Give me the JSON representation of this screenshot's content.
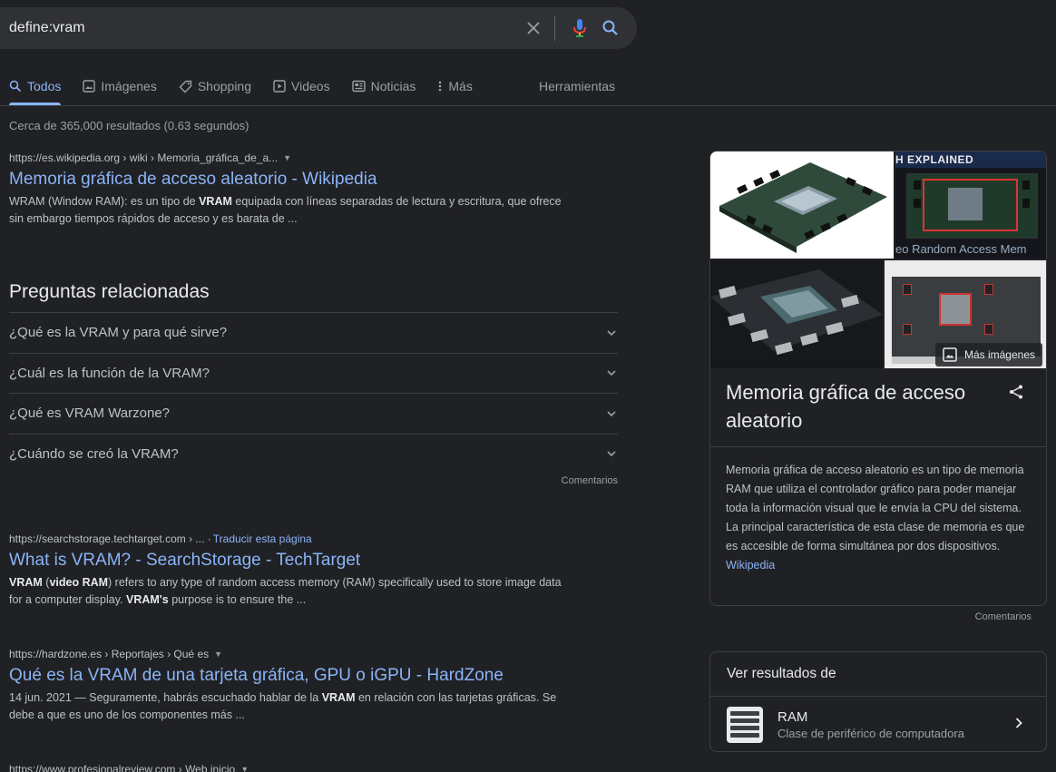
{
  "search": {
    "query": "define:vram"
  },
  "tabs": [
    {
      "label": "Todos",
      "icon": "search-icon"
    },
    {
      "label": "Imágenes",
      "icon": "image-icon"
    },
    {
      "label": "Shopping",
      "icon": "tag-icon"
    },
    {
      "label": "Videos",
      "icon": "video-icon"
    },
    {
      "label": "Noticias",
      "icon": "news-icon"
    },
    {
      "label": "Más",
      "icon": "more-vert-icon"
    }
  ],
  "tools_label": "Herramientas",
  "stats": "Cerca de 365,000 resultados (0.63 segundos)",
  "results": [
    {
      "cite": "https://es.wikipedia.org › wiki › Memoria_gráfica_de_a...",
      "title": "Memoria gráfica de acceso aleatorio - Wikipedia",
      "snippet": [
        {
          "t": "WRAM (Window RAM): es un tipo de "
        },
        {
          "t": "VRAM",
          "b": true
        },
        {
          "t": " equipada con líneas separadas de lectura y escritura, que ofrece sin embargo tiempos rápidos de acceso y es barata de ..."
        }
      ]
    },
    {
      "cite": "https://searchstorage.techtarget.com › ... ·",
      "translate": "Traducir esta página",
      "title": "What is VRAM? - SearchStorage - TechTarget",
      "snippet": [
        {
          "t": "VRAM",
          "b": true
        },
        {
          "t": " ("
        },
        {
          "t": "video RAM",
          "b": true
        },
        {
          "t": ") refers to any type of random access memory (RAM) specifically used to store image data for a computer display. "
        },
        {
          "t": "VRAM's",
          "b": true
        },
        {
          "t": " purpose is to ensure the ..."
        }
      ]
    },
    {
      "cite": "https://hardzone.es › Reportajes › Qué es",
      "title": "Qué es la VRAM de una tarjeta gráfica, GPU o iGPU - HardZone",
      "snippet": [
        {
          "t": "14 jun. 2021 — Seguramente, habrás escuchado hablar de la "
        },
        {
          "t": "VRAM",
          "b": true
        },
        {
          "t": " en relación con las tarjetas gráficas. Se debe a que es uno de los componentes más ..."
        }
      ]
    },
    {
      "cite": "https://www.profesionalreview.com › Web inicio"
    }
  ],
  "paa": {
    "title": "Preguntas relacionadas",
    "questions": [
      "¿Qué es la VRAM y para qué sirve?",
      "¿Cuál es la función de la VRAM?",
      "¿Qué es VRAM Warzone?",
      "¿Cuándo se creó la VRAM?"
    ],
    "feedback": "Comentarios"
  },
  "knowledge_panel": {
    "image_caption_top": "H EXPLAINED",
    "image_caption_bottom": "eo Random Access Mem",
    "more_images": "Más imágenes",
    "title": "Memoria gráfica de acceso aleatorio",
    "description": "Memoria gráfica de acceso aleatorio es un tipo de memoria RAM que utiliza el controlador gráfico para poder manejar toda la información visual que le envía la CPU del sistema. La principal característica de esta clase de memoria es que es accesible de forma simultánea por dos dispositivos.",
    "source": "Wikipedia",
    "feedback": "Comentarios"
  },
  "see_results": {
    "title": "Ver resultados de",
    "item_name": "RAM",
    "item_sub": "Clase de periférico de computadora"
  },
  "colors": {
    "bg": "#202124",
    "link": "#8ab4f8",
    "text": "#bdc1c6",
    "title": "#e8eaed"
  }
}
